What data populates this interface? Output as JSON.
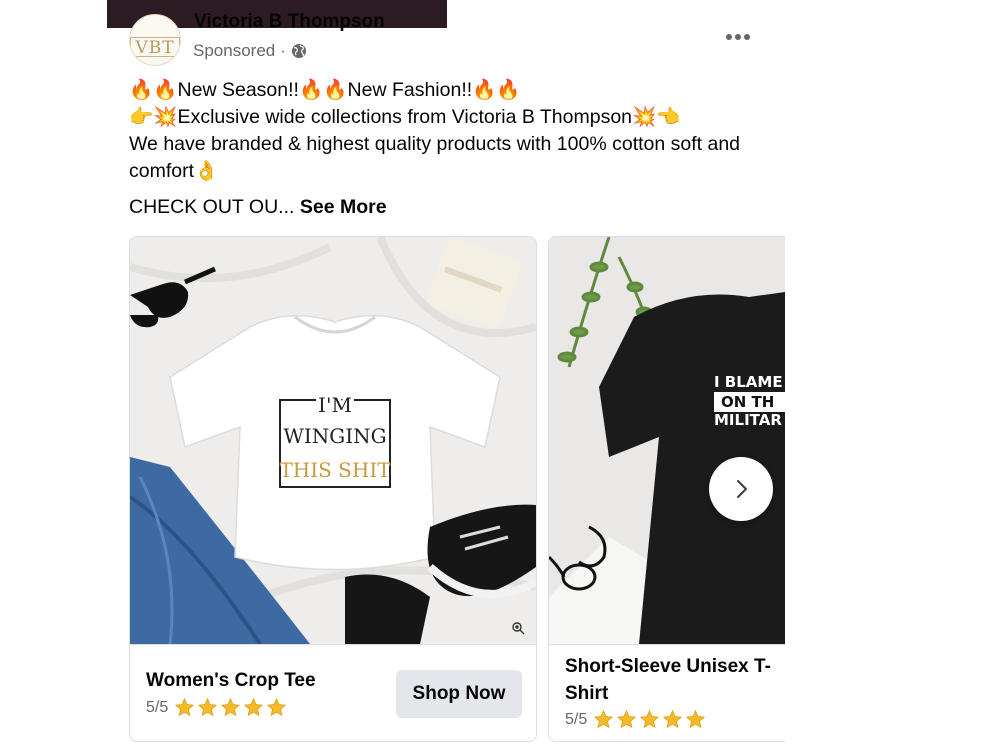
{
  "post": {
    "page_name": "Victoria B Thompson",
    "sponsored_label": "Sponsored",
    "separator": "·",
    "avatar_text": "VBT",
    "text_line1": "🔥🔥New Season!!🔥🔥New Fashion!!🔥🔥",
    "text_line2": "👉💥Exclusive wide collections from Victoria B Thompson💥👈",
    "text_line3": "We have branded & highest quality products with 100% cotton soft and comfort👌",
    "truncated_text": "CHECK OUT OU...",
    "see_more_label": "See More"
  },
  "cards": [
    {
      "title": "Women's Crop Tee",
      "rating": "5/5",
      "stars": 5,
      "button_label": "Shop Now",
      "shirt_text": [
        "I'M",
        "WINGING",
        "THIS SHIT"
      ]
    },
    {
      "title": "Short-Sleeve Unisex T-Shirt",
      "rating": "5/5",
      "stars": 5,
      "shirt_text": [
        "I BLAME",
        "ON TH",
        "MILITAR"
      ]
    }
  ],
  "icons": {
    "more": "more-options-icon",
    "globe": "globe-icon",
    "star": "star-icon",
    "next": "chevron-right-icon",
    "zoom": "zoom-icon"
  },
  "colors": {
    "star": "#f7b928",
    "text_secondary": "#65676b",
    "button_bg": "#e4e6eb"
  }
}
